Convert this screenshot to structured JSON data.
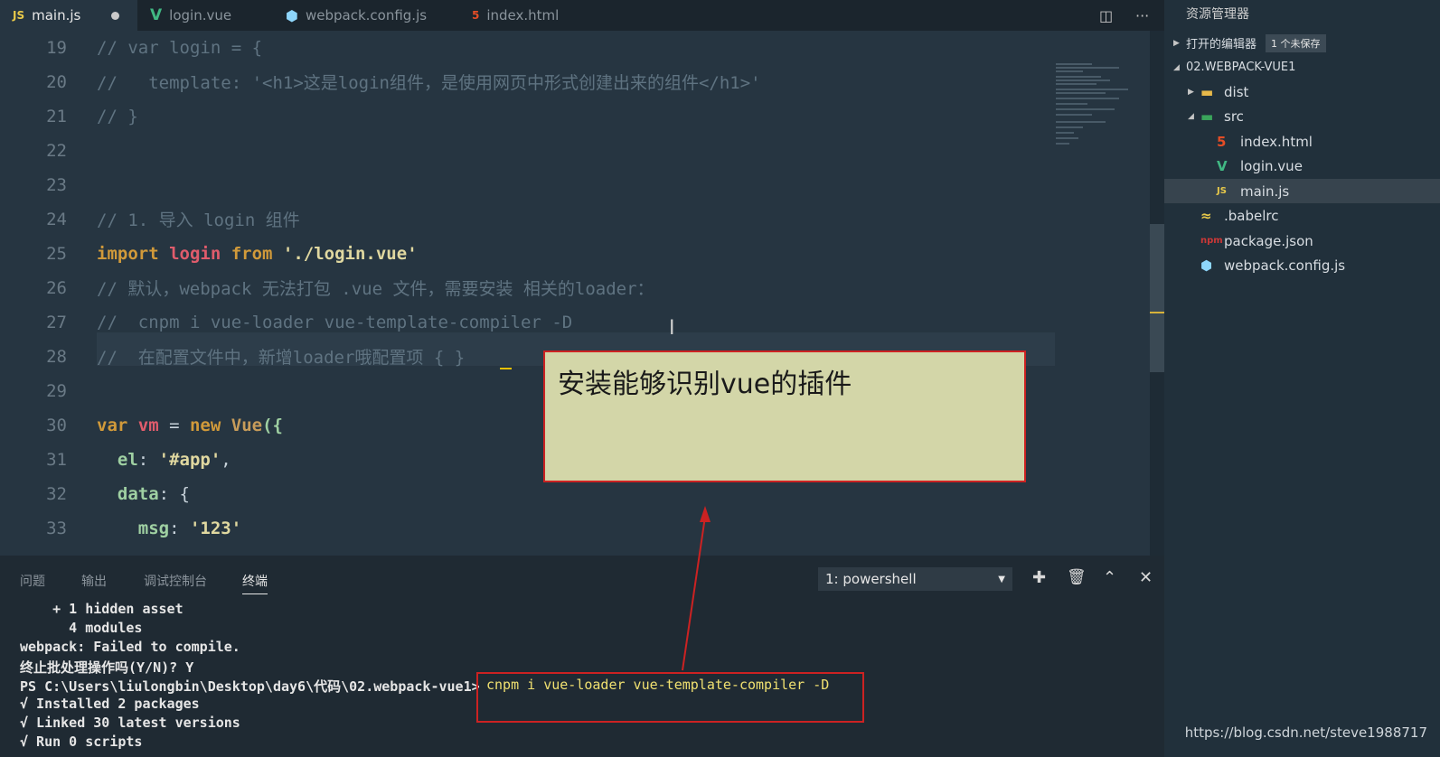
{
  "tabs": [
    {
      "icon": "JS",
      "label": "main.js",
      "modified": true
    },
    {
      "icon": "V",
      "label": "login.vue"
    },
    {
      "icon": "⬢",
      "label": "webpack.config.js"
    },
    {
      "icon": "5",
      "label": "index.html"
    }
  ],
  "editor": {
    "lines": [
      {
        "num": "19",
        "tokens": [
          {
            "t": "// var login = {",
            "c": "cm"
          }
        ]
      },
      {
        "num": "20",
        "tokens": [
          {
            "t": "//   template: '<h1>这是login组件，是使用网页中形式创建出来的组件</h1>'",
            "c": "cm"
          }
        ]
      },
      {
        "num": "21",
        "tokens": [
          {
            "t": "// }",
            "c": "cm"
          }
        ]
      },
      {
        "num": "22",
        "tokens": []
      },
      {
        "num": "23",
        "tokens": []
      },
      {
        "num": "24",
        "tokens": [
          {
            "t": "// 1. 导入 login 组件",
            "c": "cm"
          }
        ]
      },
      {
        "num": "25",
        "tokens": [
          {
            "t": "import ",
            "c": "kw"
          },
          {
            "t": "login ",
            "c": "var"
          },
          {
            "t": "from ",
            "c": "kw"
          },
          {
            "t": "'./login.vue'",
            "c": "str"
          }
        ]
      },
      {
        "num": "26",
        "tokens": [
          {
            "t": "// 默认，webpack 无法打包 .vue 文件，需要安装 相关的loader：",
            "c": "cm"
          }
        ]
      },
      {
        "num": "27",
        "tokens": [
          {
            "t": "//  cnpm i vue-loader vue-template-compiler -D",
            "c": "cm"
          }
        ]
      },
      {
        "num": "28",
        "tokens": [
          {
            "t": "//  在配置文件中，新增loader哦配置项 { }",
            "c": "cm"
          }
        ]
      },
      {
        "num": "29",
        "tokens": []
      },
      {
        "num": "30",
        "tokens": [
          {
            "t": "var ",
            "c": "kw"
          },
          {
            "t": "vm ",
            "c": "var"
          },
          {
            "t": "= ",
            "c": "code"
          },
          {
            "t": "new ",
            "c": "kw"
          },
          {
            "t": "Vue",
            "c": "cls"
          },
          {
            "t": "({",
            "c": "prop"
          }
        ]
      },
      {
        "num": "31",
        "tokens": [
          {
            "t": "  el",
            "c": "prop"
          },
          {
            "t": ": ",
            "c": "code"
          },
          {
            "t": "'#app'",
            "c": "str"
          },
          {
            "t": ",",
            "c": "code"
          }
        ]
      },
      {
        "num": "32",
        "tokens": [
          {
            "t": "  data",
            "c": "prop"
          },
          {
            "t": ": {",
            "c": "code"
          }
        ]
      },
      {
        "num": "33",
        "tokens": [
          {
            "t": "    msg",
            "c": "prop"
          },
          {
            "t": ": ",
            "c": "code"
          },
          {
            "t": "'123'",
            "c": "str"
          }
        ]
      }
    ]
  },
  "sidebar": {
    "title": "资源管理器",
    "open_editors": "打开的编辑器",
    "unsaved_badge": "1 个未保存",
    "project": "02.WEBPACK-VUE1",
    "items": [
      {
        "label": "dist",
        "icon": "folder-icon"
      },
      {
        "label": "src",
        "icon": "folder-open-icon"
      },
      {
        "label": "index.html",
        "icon": "html-icon"
      },
      {
        "label": "login.vue",
        "icon": "vue-icon"
      },
      {
        "label": "main.js",
        "icon": "js-icon"
      },
      {
        "label": ".babelrc",
        "icon": "babel-icon"
      },
      {
        "label": "package.json",
        "icon": "npm-icon"
      },
      {
        "label": "webpack.config.js",
        "icon": "webpack-icon"
      }
    ]
  },
  "panel": {
    "tabs": [
      "问题",
      "输出",
      "调试控制台",
      "终端"
    ],
    "shell": "1: powershell",
    "terminal": [
      "    + 1 hidden asset",
      "      4 modules",
      "webpack: Failed to compile.",
      "终止批处理操作吗(Y/N)? Y",
      "PS C:\\Users\\liulongbin\\Desktop\\day6\\代码\\02.webpack-vue1>",
      "√ Installed 2 packages",
      "√ Linked 30 latest versions",
      "√ Run 0 scripts"
    ],
    "command": "cnpm i vue-loader vue-template-compiler -D"
  },
  "annotation": "安装能够识别vue的插件",
  "watermark": "https://blog.csdn.net/steve1988717"
}
